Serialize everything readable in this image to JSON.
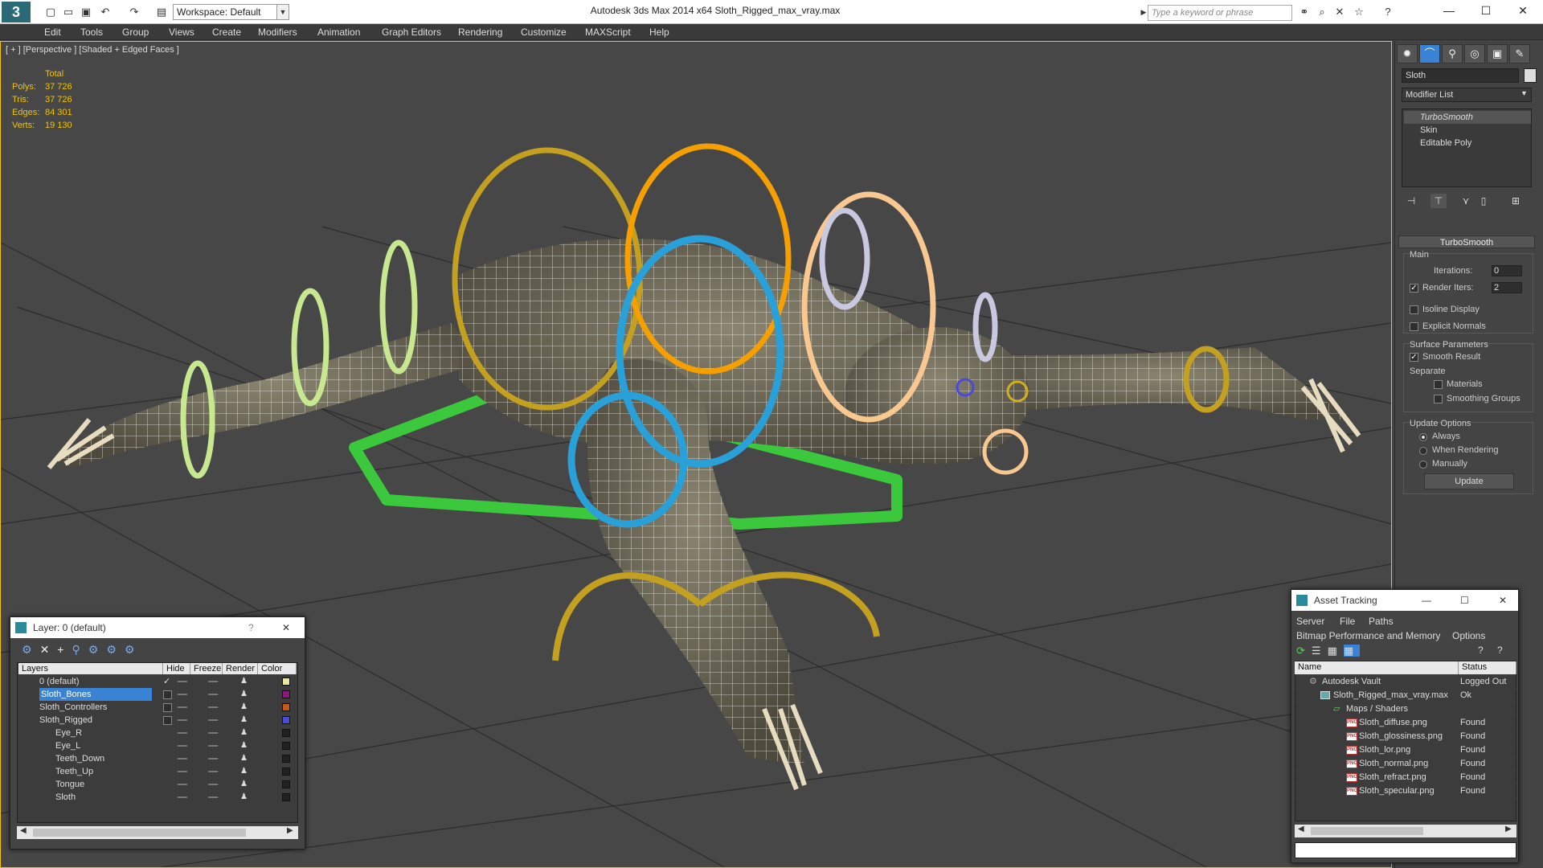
{
  "app": {
    "logo": "3",
    "window_title": "Autodesk 3ds Max  2014 x64       Sloth_Rigged_max_vray.max",
    "workspace": "Workspace: Default",
    "search_placeholder": "Type a keyword or phrase"
  },
  "menu": [
    "Edit",
    "Tools",
    "Group",
    "Views",
    "Create",
    "Modifiers",
    "Animation",
    "Graph Editors",
    "Rendering",
    "Customize",
    "MAXScript",
    "Help"
  ],
  "viewport": {
    "label": "[ + ] [Perspective ] [Shaded + Edged Faces ]",
    "stats_header": "Total",
    "stats": [
      {
        "label": "Polys:",
        "value": "37 726"
      },
      {
        "label": "Tris:",
        "value": "37 726"
      },
      {
        "label": "Edges:",
        "value": "84 301"
      },
      {
        "label": "Verts:",
        "value": "19 130"
      }
    ]
  },
  "command_panel": {
    "object_name": "Sloth",
    "modifier_list": "Modifier List",
    "stack": [
      "TurboSmooth",
      "Skin",
      "Editable Poly"
    ],
    "rollout_title": "TurboSmooth",
    "main_label": "Main",
    "iterations_label": "Iterations:",
    "iterations_value": "0",
    "render_iters_label": "Render Iters:",
    "render_iters_value": "2",
    "isoline": "Isoline Display",
    "explicit_normals": "Explicit Normals",
    "surface_params": "Surface Parameters",
    "smooth_result": "Smooth Result",
    "separate": "Separate",
    "materials": "Materials",
    "smoothing_groups": "Smoothing Groups",
    "update_options": "Update Options",
    "always": "Always",
    "when_rendering": "When Rendering",
    "manually": "Manually",
    "update_button": "Update"
  },
  "layer_window": {
    "title": "Layer: 0 (default)",
    "help": "?",
    "close": "✕",
    "columns": {
      "layers": "Layers",
      "hide": "Hide",
      "freeze": "Freeze",
      "render": "Render",
      "color": "Color"
    },
    "rows": [
      {
        "name": "0 (default)",
        "color": "#e8e8a0"
      },
      {
        "name": "Sloth_Bones",
        "color": "#8a1a7a"
      },
      {
        "name": "Sloth_Controllers",
        "color": "#c8561a"
      },
      {
        "name": "Sloth_Rigged",
        "color": "#4a4ad8"
      },
      {
        "name": "Eye_R",
        "color": "#222222"
      },
      {
        "name": "Eye_L",
        "color": "#222222"
      },
      {
        "name": "Teeth_Down",
        "color": "#222222"
      },
      {
        "name": "Teeth_Up",
        "color": "#222222"
      },
      {
        "name": "Tongue",
        "color": "#222222"
      },
      {
        "name": "Sloth",
        "color": "#222222"
      }
    ]
  },
  "asset_window": {
    "title": "Asset Tracking",
    "menu": [
      "Server",
      "File",
      "Paths"
    ],
    "menu2": [
      "Bitmap Performance and Memory",
      "Options"
    ],
    "col_name": "Name",
    "col_status": "Status",
    "png_badge": "PNG",
    "rows": [
      {
        "name": "Autodesk Vault",
        "status": "Logged Out"
      },
      {
        "name": "Sloth_Rigged_max_vray.max",
        "status": "Ok"
      },
      {
        "name": "Maps / Shaders",
        "status": ""
      },
      {
        "name": "Sloth_diffuse.png",
        "status": "Found"
      },
      {
        "name": "Sloth_glossiness.png",
        "status": "Found"
      },
      {
        "name": "Sloth_lor.png",
        "status": "Found"
      },
      {
        "name": "Sloth_normal.png",
        "status": "Found"
      },
      {
        "name": "Sloth_refract.png",
        "status": "Found"
      },
      {
        "name": "Sloth_specular.png",
        "status": "Found"
      }
    ]
  },
  "colors": {
    "selection_yellow": "#f2c500",
    "selection_blue": "#3a82d4",
    "ring_orange": "#f5a000",
    "ring_olive": "#c4a020",
    "ring_lime": "#c8e890",
    "ring_blue": "#2aa0d8",
    "ring_peach": "#f8c890",
    "control_green": "#3cc83c"
  }
}
